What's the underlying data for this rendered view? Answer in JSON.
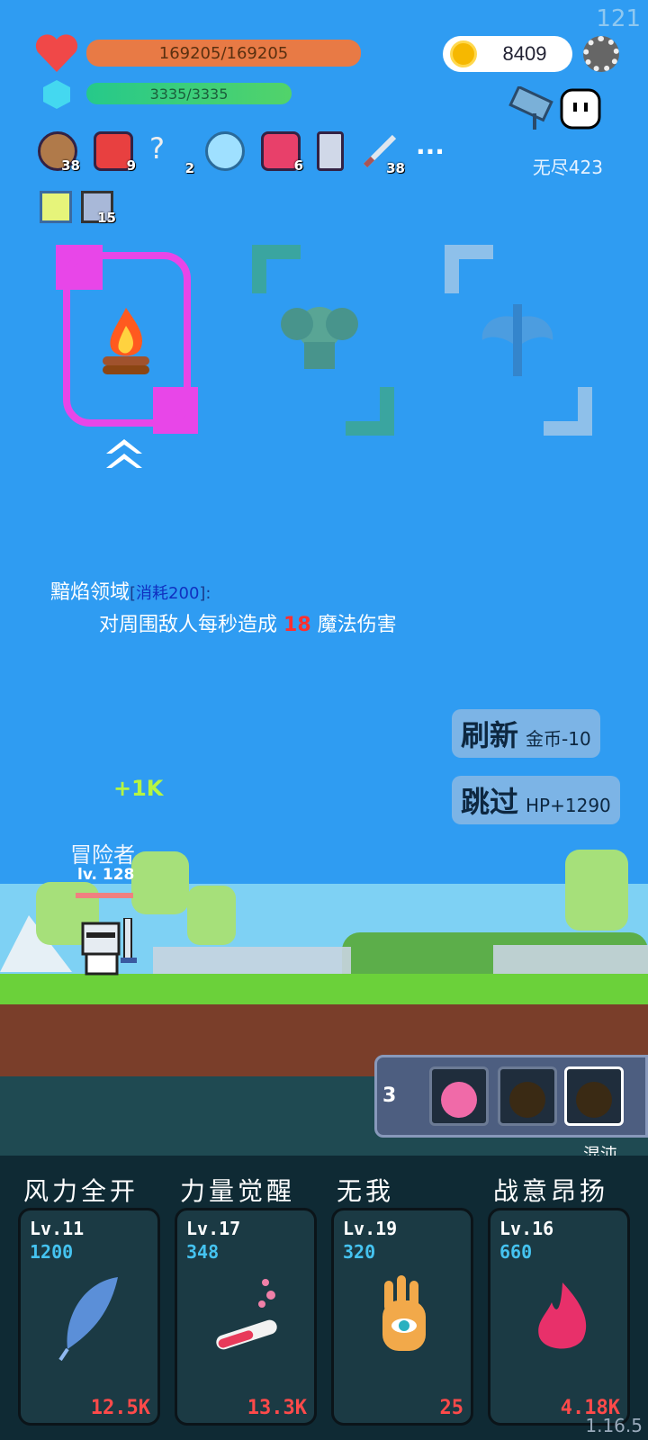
{
  "fps": "121",
  "version": "1.16.5",
  "hp": "169205/169205",
  "mp": "3335/3335",
  "coins": "8409",
  "endless_label": "无尽423",
  "inventory": [
    {
      "icon": "shield-icon",
      "count": "38"
    },
    {
      "icon": "sock-icon",
      "count": "9"
    },
    {
      "icon": "hook-icon",
      "count": "2"
    },
    {
      "icon": "magnifier-icon",
      "count": ""
    },
    {
      "icon": "jam-jar-icon",
      "count": "6"
    },
    {
      "icon": "mace-icon",
      "count": ""
    },
    {
      "icon": "sword-icon",
      "count": "38"
    }
  ],
  "inventory_more": "···",
  "inventory2": [
    {
      "icon": "lamp-icon",
      "count": ""
    },
    {
      "icon": "shard-icon",
      "count": "15"
    }
  ],
  "skill_offer": {
    "name": "黯焰领域",
    "cost_open": "[",
    "cost": "消耗200",
    "cost_close": "]:",
    "desc_pre": "对周围敌人每秒造成",
    "desc_value": "18",
    "desc_post": "魔法伤害"
  },
  "refresh_button": {
    "label": "刷新",
    "cost": "金币-10"
  },
  "skip_button": {
    "label": "跳过",
    "reward": "HP+1290"
  },
  "gain_text": "+1K",
  "hero": {
    "name": "冒险者",
    "level": "lv. 128"
  },
  "potions": {
    "count": "3",
    "selected_label": "混沌"
  },
  "skills": [
    {
      "name": "风力全开",
      "level": "Lv.11",
      "cost": "1200",
      "damage": "12.5K",
      "icon": "feather-icon"
    },
    {
      "name": "力量觉醒",
      "level": "Lv.17",
      "cost": "348",
      "damage": "13.3K",
      "icon": "test-tube-icon"
    },
    {
      "name": "无我",
      "level": "Lv.19",
      "cost": "320",
      "damage": "25",
      "icon": "eye-hand-icon"
    },
    {
      "name": "战意昂扬",
      "level": "Lv.16",
      "cost": "660",
      "damage": "4.18K",
      "icon": "flame-icon"
    }
  ]
}
